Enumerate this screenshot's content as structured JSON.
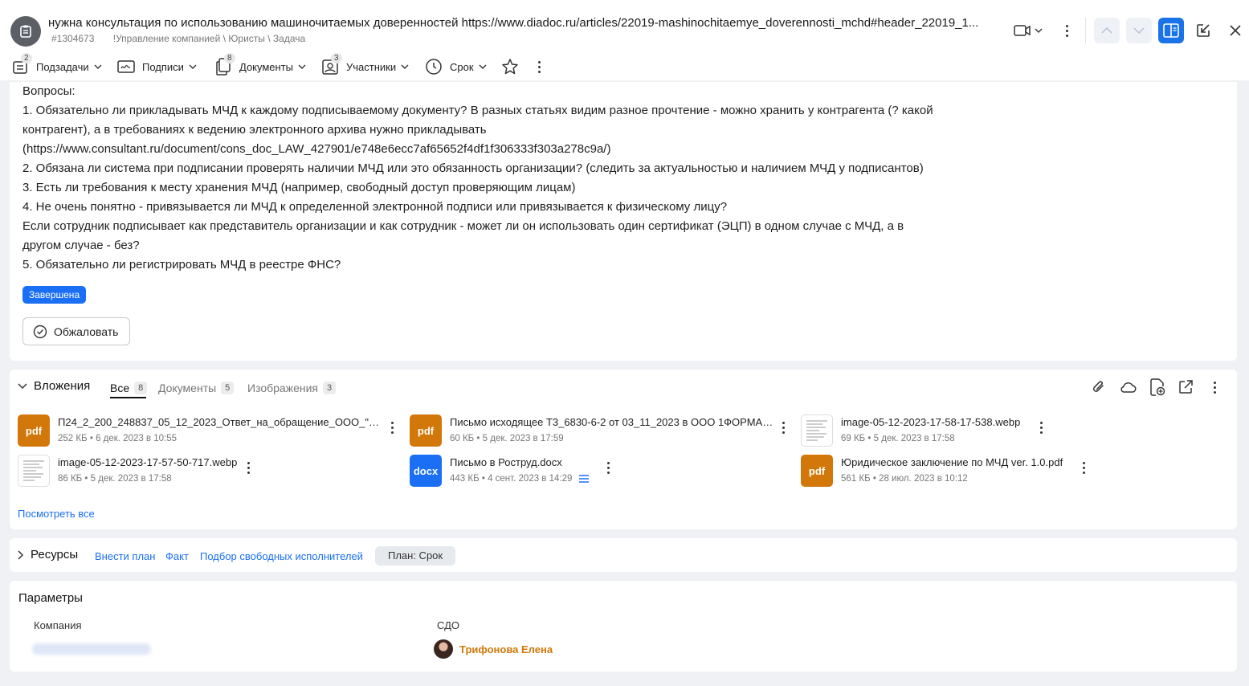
{
  "header": {
    "title": "нужна консультация по использованию машиночитаемых доверенностей https://www.diadoc.ru/articles/22019-mashinochitaemye_doverennosti_mchd#header_22019_1...",
    "id": "#1304673",
    "path": "!Управление компанией \\ Юристы \\ Задача"
  },
  "toolbar": [
    {
      "label": "Подзадачи",
      "badge": "2",
      "icon": "subtasks-icon"
    },
    {
      "label": "Подписи",
      "badge": "",
      "icon": "signature-icon"
    },
    {
      "label": "Документы",
      "badge": "8",
      "icon": "documents-icon"
    },
    {
      "label": "Участники",
      "badge": "3",
      "icon": "participants-icon"
    },
    {
      "label": "Срок",
      "badge": "",
      "icon": "clock-icon"
    }
  ],
  "description": {
    "lines": [
      "Вопросы:",
      "1. Обязательно ли прикладывать МЧД к каждому подписываемому документу? В разных статьях видим разное прочтение - можно хранить у контрагента (? какой",
      "контрагент), а в требованиях к ведению электронного архива нужно прикладывать",
      "(https://www.consultant.ru/document/cons_doc_LAW_427901/e748e6ecc7af65652f4df1f306333f303a278c9a/)",
      "2. Обязана ли система при подписании проверять наличии МЧД или это обязанность организации? (следить за актуальностью и наличием МЧД у подписантов)",
      "3. Есть ли требования к месту хранения МЧД (например, свободный доступ проверяющим лицам)",
      "4. Не очень понятно - привязывается ли МЧД к определенной электронной подписи или привязывается к физическому лицу?",
      "Если сотрудник подписывает как представитель организации и как сотрудник - может ли он использовать один сертификат (ЭЦП) в одном случае с МЧД, а в",
      "другом случае - без?",
      "5. Обязательно ли регистрировать МЧД в реестре ФНС?"
    ],
    "status": "Завершена",
    "appeal_label": "Обжаловать"
  },
  "attachments": {
    "title": "Вложения",
    "tabs": [
      {
        "label": "Все",
        "count": "8"
      },
      {
        "label": "Документы",
        "count": "5"
      },
      {
        "label": "Изображения",
        "count": "3"
      }
    ],
    "files": [
      {
        "type": "pdf",
        "name": "П24_2_200_248837_05_12_2023_Ответ_на_обращение_ООО_\"1Фор...",
        "size": "252 КБ",
        "date": "6 дек. 2023 в 10:55"
      },
      {
        "type": "pdf",
        "name": "Письмо исходящее Т3_6830-6-2 от 03_11_2023 в ООО 1ФОРМА П...",
        "size": "60 КБ",
        "date": "5 дек. 2023 в 17:59"
      },
      {
        "type": "img",
        "name": "image-05-12-2023-17-58-17-538.webp",
        "size": "69 КБ",
        "date": "5 дек. 2023 в 17:58"
      },
      {
        "type": "img",
        "name": "image-05-12-2023-17-57-50-717.webp",
        "size": "86 КБ",
        "date": "5 дек. 2023 в 17:58"
      },
      {
        "type": "docx",
        "name": "Письмо в Роструд.docx",
        "size": "443 КБ",
        "date": "4 сент. 2023 в 14:29"
      },
      {
        "type": "pdf",
        "name": "Юридическое заключение по МЧД ver. 1.0.pdf",
        "size": "561 КБ",
        "date": "28 июл. 2023 в 10:12"
      }
    ],
    "view_all": "Посмотреть все"
  },
  "resources": {
    "title": "Ресурсы",
    "links": [
      "Внести план",
      "Факт",
      "Подбор свободных исполнителей"
    ],
    "chip": "План: Срок"
  },
  "params": {
    "title": "Параметры",
    "company_label": "Компания",
    "sdo_label": "СДО",
    "sdo_user": "Трифонова Елена"
  },
  "colors": {
    "accent": "#1a6ff5",
    "pdf": "#d2780a",
    "user_name": "#d2780a"
  }
}
